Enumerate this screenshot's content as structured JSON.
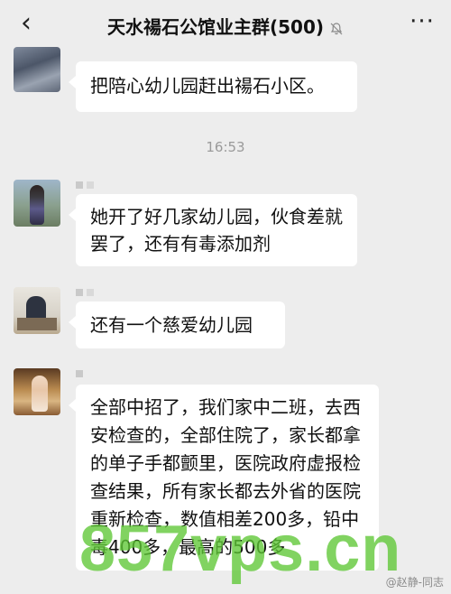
{
  "header": {
    "title": "天水禓石公馆业主群(500)",
    "back_icon": "chevron-left-icon",
    "mute_icon": "bell-off-icon",
    "more_label": "···"
  },
  "messages": [
    {
      "text": "把陪心幼儿园赶出禓石小区。"
    },
    {
      "text": "她开了好几家幼儿园，伙食差就罢了，还有有毒添加剂"
    },
    {
      "text": "还有一个慈爱幼儿园"
    },
    {
      "text": "全部中招了，我们家中二班，去西安检查的，全部住院了，家长都拿的单子手都颤里，医院政府虚报检查结果，所有家长都去外省的医院重新检查，数值相差200多，铅中毒400多，最高的500多"
    }
  ],
  "timestamp": "16:53",
  "watermark": "857vps.cn",
  "credit": "@赵静-同志"
}
